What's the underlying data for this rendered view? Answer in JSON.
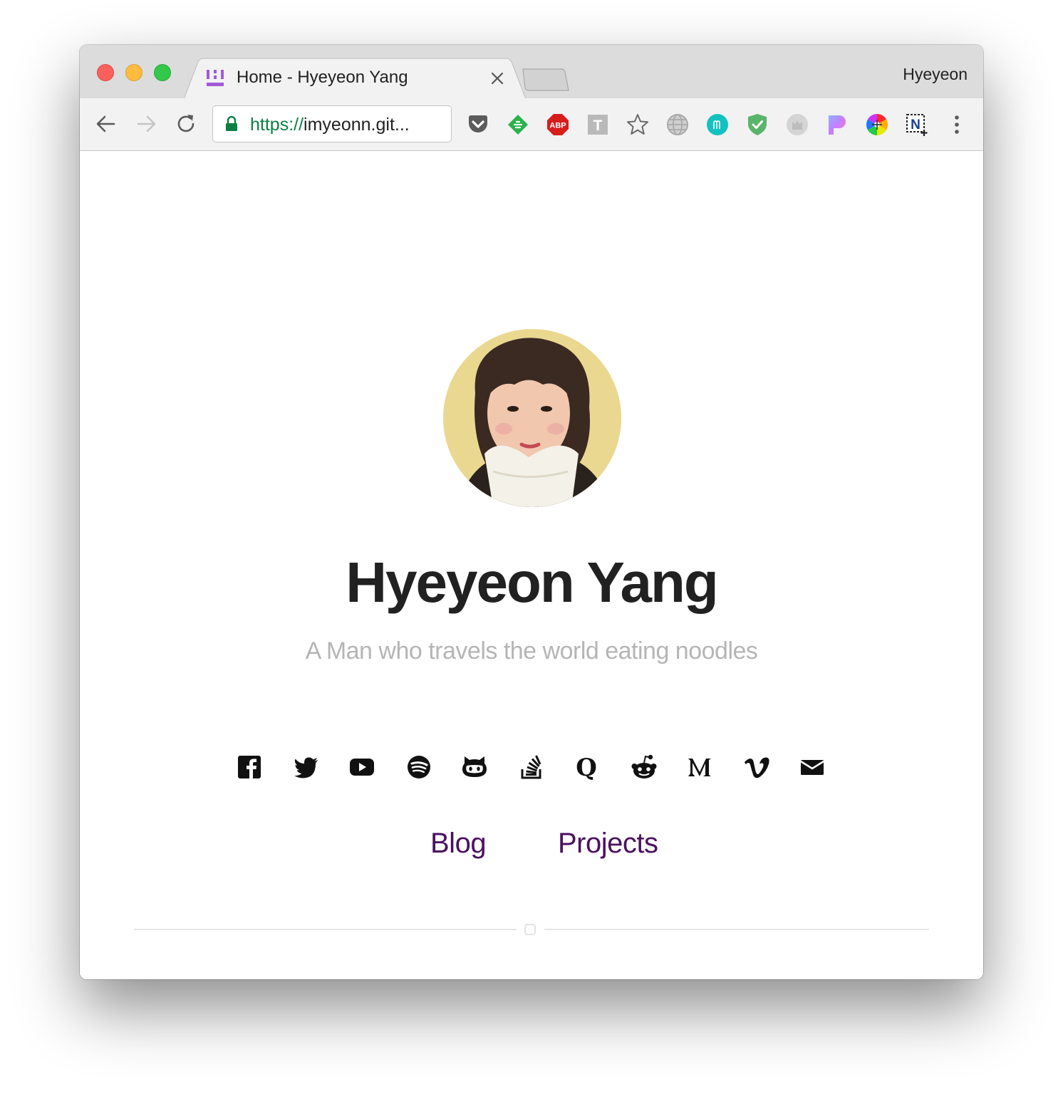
{
  "window": {
    "profile_name": "Hyeyeon",
    "tabs": [
      {
        "title": "Home - Hyeyeon Yang",
        "favicon": "site-logo-icon",
        "active": true
      }
    ]
  },
  "toolbar": {
    "back_icon": "arrow-left-icon",
    "forward_icon": "arrow-right-icon",
    "reload_icon": "reload-icon",
    "url": {
      "scheme": "https://",
      "rest": "imyeonn.git..."
    },
    "extensions": [
      "pocket-icon",
      "feedly-icon",
      "adblock-plus-icon",
      "t-extension-icon",
      "bookmark-star-icon",
      "globe-icon",
      "m-extension-icon",
      "shield-check-icon",
      "gray-extension-icon",
      "gradient-extension-icon",
      "color-wheel-icon",
      "n-plus-icon",
      "menu-kebab-icon"
    ]
  },
  "page": {
    "name": "Hyeyeon Yang",
    "tagline": "A Man who travels the world eating noodles",
    "socials": [
      "facebook-icon",
      "twitter-icon",
      "youtube-icon",
      "spotify-icon",
      "github-icon",
      "stackoverflow-icon",
      "quora-icon",
      "reddit-icon",
      "medium-icon",
      "vimeo-icon",
      "email-icon"
    ],
    "links": [
      {
        "label": "Blog"
      },
      {
        "label": "Projects"
      }
    ]
  },
  "colors": {
    "link": "#4b1161",
    "tagline": "#b5b5b5",
    "name": "#212121",
    "secure_green": "#0b8043"
  }
}
